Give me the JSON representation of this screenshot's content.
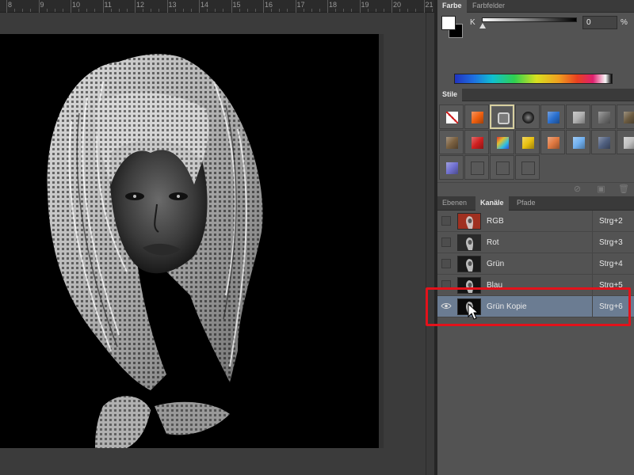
{
  "ruler": {
    "labels": [
      "8",
      "9",
      "10",
      "11",
      "12",
      "13",
      "14",
      "15",
      "16",
      "17",
      "18",
      "19",
      "20",
      "21"
    ]
  },
  "color_panel": {
    "tabs": [
      "Farbe",
      "Farbfelder"
    ],
    "active_tab": "Farbe",
    "channel_label": "K",
    "value": "0",
    "unit": "%",
    "foreground": "#ffffff",
    "background": "#000000"
  },
  "styles_panel": {
    "title": "Stile",
    "swatches": [
      {
        "icon": "no-style-icon",
        "color": "#ffffff"
      },
      {
        "icon": "orange-glow-style",
        "color": "#f06010"
      },
      {
        "icon": "gray-frame-style",
        "color": "#888888"
      },
      {
        "icon": "dark-button-style",
        "color": "#1a1a1a"
      },
      {
        "icon": "blue-gel-style",
        "color": "#2a70d0"
      },
      {
        "icon": "gray-plate-style",
        "color": "#b0b0b0"
      },
      {
        "icon": "dark-bevel-style",
        "color": "#707070"
      },
      {
        "icon": "bronze-style",
        "color": "#6a5a40"
      },
      {
        "icon": "wood-style",
        "color": "#7a6040"
      },
      {
        "icon": "red-button-style",
        "color": "#d02020"
      },
      {
        "icon": "rainbow-style",
        "color": "#40a0e0"
      },
      {
        "icon": "gold-style",
        "color": "#e8c010"
      },
      {
        "icon": "sunset-style",
        "color": "#e07840"
      },
      {
        "icon": "sky-style",
        "color": "#70b0f0"
      },
      {
        "icon": "landscape-style",
        "color": "#506080"
      },
      {
        "icon": "pattern-style",
        "color": "#c0c0c0"
      },
      {
        "icon": "purple-gel-style",
        "color": "#7070d0"
      },
      {
        "icon": "empty-style",
        "color": "#595959"
      },
      {
        "icon": "empty-style",
        "color": "#595959"
      },
      {
        "icon": "empty-style",
        "color": "#595959"
      }
    ]
  },
  "channels_panel": {
    "tabs": [
      "Ebenen",
      "Kanäle",
      "Pfade"
    ],
    "active_tab": "Kanäle",
    "channels": [
      {
        "name": "RGB",
        "shortcut": "Strg+2",
        "visible": false,
        "selected": false,
        "thumb": "#a03020"
      },
      {
        "name": "Rot",
        "shortcut": "Strg+3",
        "visible": false,
        "selected": false,
        "thumb": "#2a2a2a"
      },
      {
        "name": "Grün",
        "shortcut": "Strg+4",
        "visible": false,
        "selected": false,
        "thumb": "#1a1a1a"
      },
      {
        "name": "Blau",
        "shortcut": "Strg+5",
        "visible": false,
        "selected": false,
        "thumb": "#151515"
      },
      {
        "name": "Grün Kopie",
        "shortcut": "Strg+6",
        "visible": true,
        "selected": true,
        "thumb": "#0a0a0a"
      }
    ]
  },
  "highlight_color": "#e3121b"
}
